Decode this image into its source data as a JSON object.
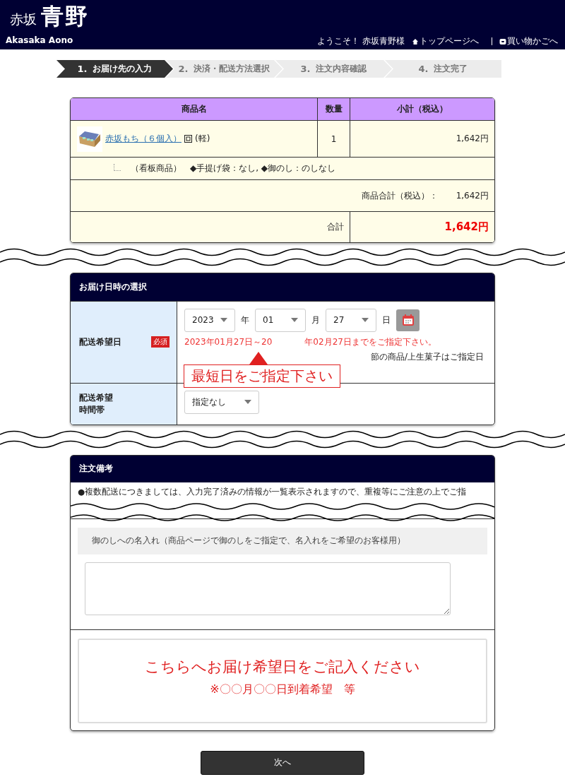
{
  "header": {
    "logo_small": "赤坂",
    "logo_large": "青野",
    "brand": "Akasaka Aono",
    "welcome": "ようこそ！ 赤坂青野様",
    "links": [
      {
        "kind": "home",
        "label": "トップページへ"
      },
      {
        "kind": "cart",
        "label": "買い物かごへ"
      }
    ]
  },
  "steps": [
    {
      "number": "1.",
      "label": "お届け先の入力",
      "selected": true
    },
    {
      "number": "2.",
      "label": "決済・配送方法選択",
      "selected": false
    },
    {
      "number": "3.",
      "label": "注文内容確認",
      "selected": false
    },
    {
      "number": "4.",
      "label": "注文完了",
      "selected": false
    }
  ],
  "cart": {
    "columns": [
      "商品名",
      "数量",
      "小計（税込）"
    ],
    "item": {
      "name": "赤坂もち（６個入）",
      "tag": "(軽)",
      "quantity": "1",
      "subtotal": "1,642円"
    },
    "options": "（看板商品）　◆手提げ袋：なし, ◆御のし：のしなし",
    "goods_total_label": "商品合計（税込）：",
    "goods_total": "1,642円",
    "total_label": "合計",
    "total": "1,642円"
  },
  "delivery": {
    "title": "お届け日時の選択",
    "date_label": "配送希望日",
    "required": "必須",
    "year": "2023",
    "year_unit": "年",
    "month": "01",
    "month_unit": "月",
    "day": "27",
    "day_unit": "日",
    "range_start": "2023年01月27日～20",
    "range_end": "年02月27日までをご指定下さい。",
    "note": "節の商品/上生菓子はご指定日",
    "callout": "最短日をご指定下さい",
    "time_label": [
      "配送希望",
      "時間帯"
    ],
    "time_value": "指定なし"
  },
  "remarks": {
    "title": "注文備考",
    "text": "●複数配送につきましては、入力完了済みの情報が一覧表示されますので、重複等にご注意の上でご指",
    "noshi_label": "御のしへの名入れ（商品ページで御のしをご指定で、名入れをご希望のお客様用）",
    "memo_lines": [
      "こちらへお届け希望日をご記入ください",
      "※〇〇月〇〇日到着希望　等"
    ]
  },
  "next_button": "次へ"
}
